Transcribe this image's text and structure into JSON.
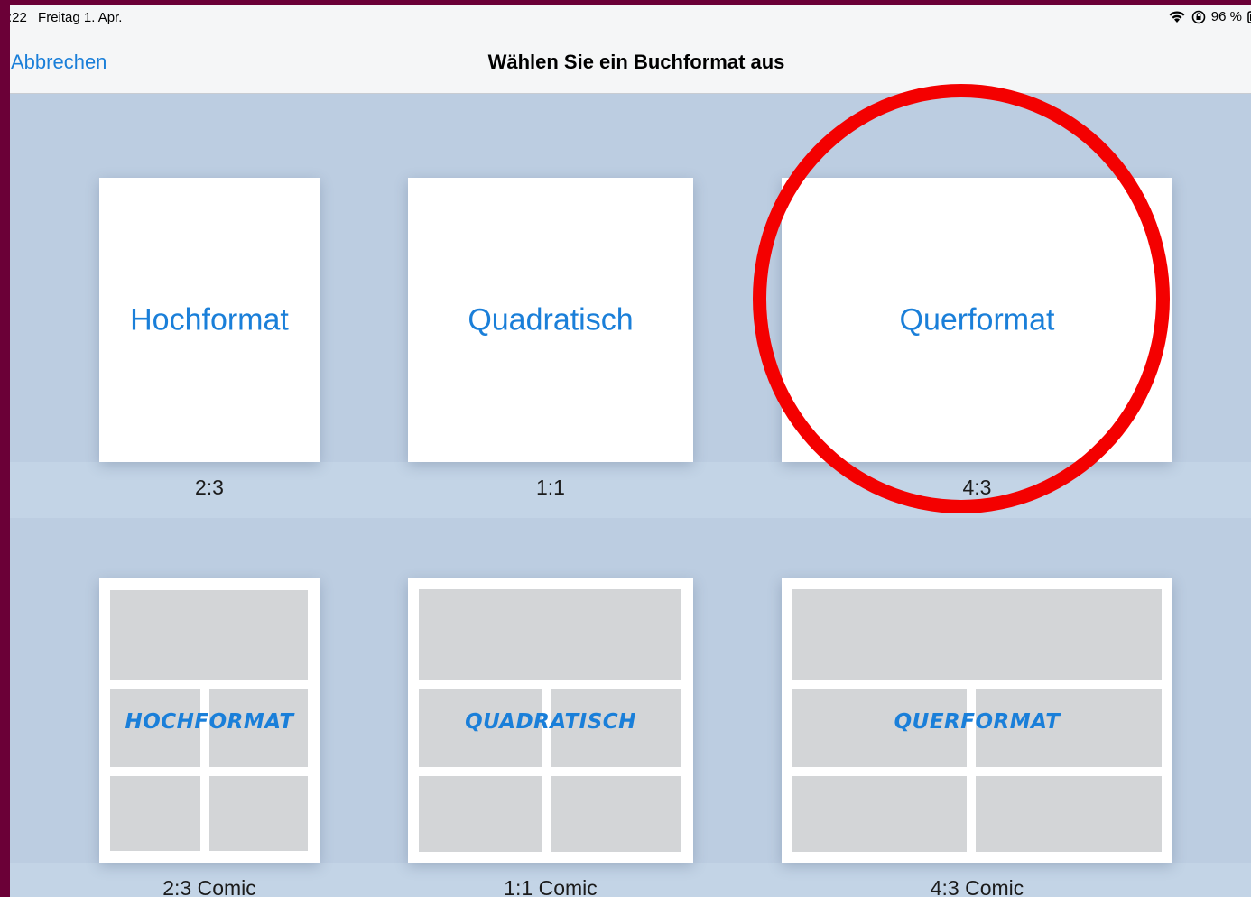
{
  "status_bar": {
    "time": ":22",
    "date": "Freitag 1. Apr.",
    "battery": "96 %",
    "icons": [
      "wifi-icon",
      "orientation-lock-icon",
      "battery-icon"
    ]
  },
  "nav": {
    "cancel_label": "Abbrechen",
    "title": "Wählen Sie ein Buchformat aus"
  },
  "formats": [
    {
      "label": "Hochformat",
      "ratio": "2:3"
    },
    {
      "label": "Quadratisch",
      "ratio": "1:1"
    },
    {
      "label": "Querformat",
      "ratio": "4:3"
    }
  ],
  "comic_formats": [
    {
      "label": "HOCHFORMAT",
      "ratio": "2:3 Comic"
    },
    {
      "label": "QUADRATISCH",
      "ratio": "1:1 Comic"
    },
    {
      "label": "QUERFORMAT",
      "ratio": "4:3 Comic"
    }
  ],
  "colors": {
    "accent": "#1a7fd9",
    "annotation": "#f40000",
    "background": "#c3d4e6",
    "panel": "#d3d5d7"
  }
}
